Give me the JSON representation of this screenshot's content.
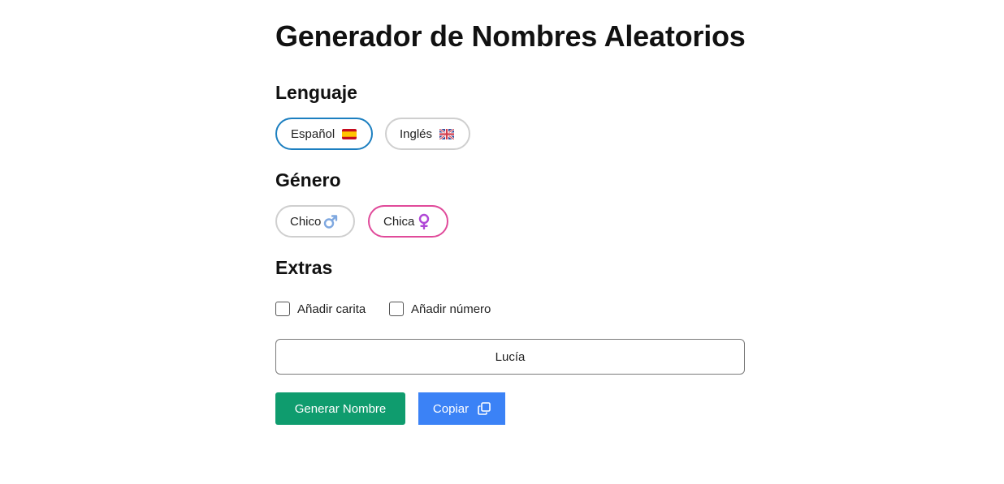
{
  "page": {
    "title": "Generador de Nombres Aleatorios"
  },
  "language": {
    "heading": "Lenguaje",
    "options": [
      {
        "label": "Español",
        "icon": "spain-flag-icon",
        "selected": true
      },
      {
        "label": "Inglés",
        "icon": "uk-flag-icon",
        "selected": false
      }
    ]
  },
  "gender": {
    "heading": "Género",
    "options": [
      {
        "label": "Chico",
        "icon": "male-symbol-icon",
        "selected": false
      },
      {
        "label": "Chica",
        "icon": "female-symbol-icon",
        "selected": true
      }
    ]
  },
  "extras": {
    "heading": "Extras",
    "options": [
      {
        "label": "Añadir carita",
        "checked": false
      },
      {
        "label": "Añadir número",
        "checked": false
      }
    ]
  },
  "result": {
    "value": "Lucía"
  },
  "actions": {
    "generate_label": "Generar Nombre",
    "copy_label": "Copiar",
    "copy_icon": "copy-icon"
  },
  "colors": {
    "language_selected": "#1c7fc0",
    "gender_selected": "#e04a9a",
    "generate_button": "#0f9c6e",
    "copy_button": "#3b82f6"
  }
}
